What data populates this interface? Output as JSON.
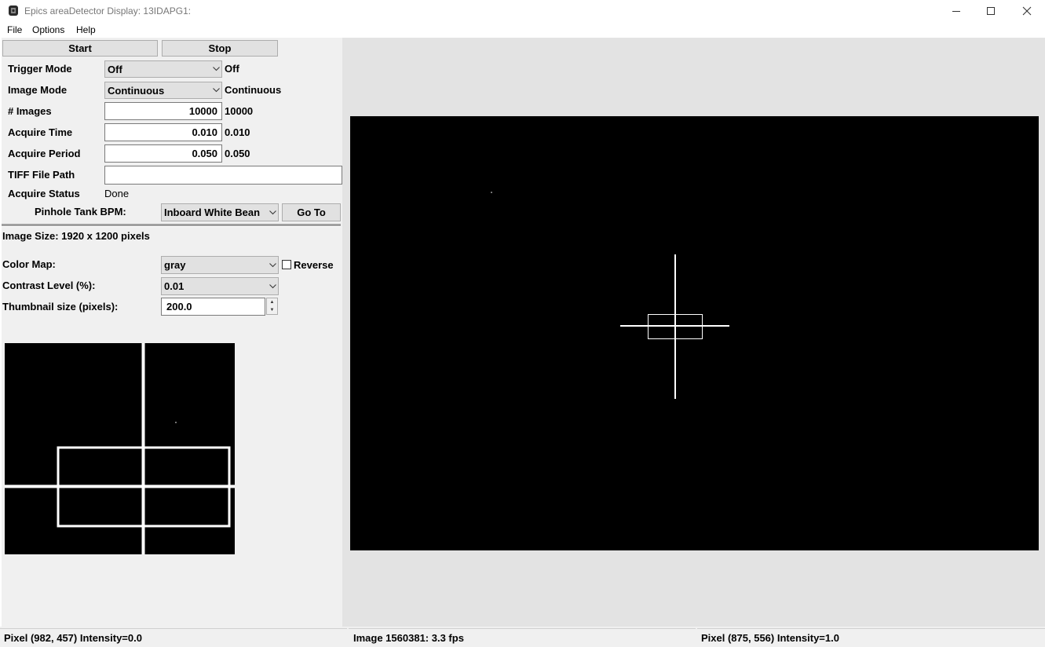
{
  "window": {
    "title": "Epics areaDetector Display: 13IDAPG1:",
    "icons": [
      "app-icon",
      "minimize-icon",
      "maximize-icon",
      "close-icon"
    ]
  },
  "menu": {
    "file": "File",
    "options": "Options",
    "help": "Help"
  },
  "controls": {
    "start_label": "Start",
    "stop_label": "Stop",
    "trigger_mode": {
      "label": "Trigger Mode",
      "value": "Off",
      "readback": "Off"
    },
    "image_mode": {
      "label": "Image Mode",
      "value": "Continuous",
      "readback": "Continuous"
    },
    "num_images": {
      "label": "# Images",
      "value": "10000",
      "readback": "10000"
    },
    "acquire_time": {
      "label": "Acquire Time",
      "value": "0.010",
      "readback": "0.010"
    },
    "acquire_period": {
      "label": "Acquire Period",
      "value": "0.050",
      "readback": "0.050"
    },
    "tiff_path": {
      "label": "TIFF File Path",
      "value": ""
    },
    "acquire_status": {
      "label": "Acquire Status",
      "value": "Done"
    },
    "pinhole": {
      "label": "Pinhole Tank BPM:",
      "value": "Inboard White Bean",
      "goto_label": "Go To"
    }
  },
  "display": {
    "image_size": "Image Size: 1920 x 1200 pixels",
    "color_map": {
      "label": "Color Map:",
      "value": "gray",
      "reverse_label": "Reverse",
      "reverse_checked": false
    },
    "contrast": {
      "label": "Contrast Level (%):",
      "value": "0.01"
    },
    "thumbnail": {
      "label": "Thumbnail size (pixels):",
      "value": "200.0"
    }
  },
  "status": {
    "left": "Pixel (982, 457) Intensity=0.0",
    "middle": "Image 1560381: 3.3 fps",
    "right": "Pixel (875, 556) Intensity=1.0"
  },
  "colors": {
    "image_bg": "#000000",
    "overlay": "#ffffff",
    "panel_bg": "#f0f0f0",
    "viewer_bg": "#e3e3e3"
  }
}
